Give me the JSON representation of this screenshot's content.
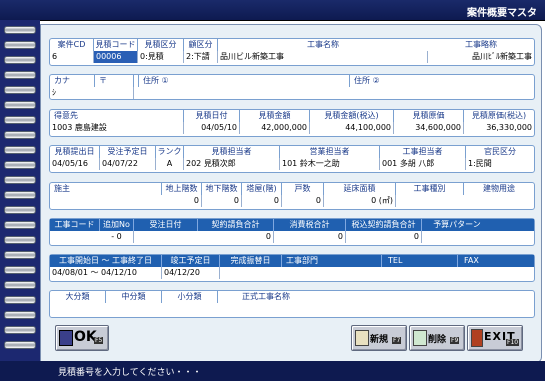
{
  "window": {
    "title": "案件概要マスタ"
  },
  "row1": {
    "headers": [
      "案件CD",
      "見積コード",
      "見積区分",
      "顧区分",
      "工事名称",
      "工事略称"
    ],
    "values": [
      "6",
      "00006",
      "0:見積",
      "2:下請",
      "品川ビル新築工事",
      "品川ﾋﾞﾙ新築工事"
    ]
  },
  "row2": {
    "headers": [
      "カナ",
      "〒",
      "住所 ①",
      "住所 ②"
    ],
    "values": [
      "ｼ",
      "",
      "",
      ""
    ]
  },
  "row3": {
    "headers": [
      "得意先",
      "見積日付",
      "見積金額",
      "見積金額(税込)",
      "見積原価",
      "見積原価(税込)"
    ],
    "values": [
      "1003 鹿島建設",
      "04/05/10",
      "42,000,000",
      "44,100,000",
      "34,600,000",
      "36,330,000"
    ]
  },
  "row4": {
    "headers": [
      "見積提出日",
      "受注予定日",
      "ランク",
      "見積担当者",
      "営業担当者",
      "工事担当者",
      "官民区分"
    ],
    "values": [
      "04/05/16",
      "04/07/22",
      "A",
      "202 見積次郎",
      "101 鈴木一之助",
      "001 多胡 八郎",
      "1:民間"
    ]
  },
  "row5": {
    "headers": [
      "施主",
      "地上階数",
      "地下階数",
      "塔屋(階)",
      "戸数",
      "延床面積",
      "工事種別",
      "建物用途"
    ],
    "values": [
      "",
      "0",
      "0",
      "0",
      "0",
      "0 (㎡)",
      "",
      ""
    ]
  },
  "row6": {
    "headers": [
      "工事コード",
      "追加No",
      "受注日付",
      "契約請負合計",
      "消費税合計",
      "税込契約請負合計",
      "予算パターン"
    ],
    "values": [
      "",
      "- 0",
      "",
      "0",
      "0",
      "0",
      ""
    ]
  },
  "row7": {
    "headers": [
      "工事開始日 ～ 工事終了日",
      "竣工予定日",
      "完成振替日",
      "工事部門",
      "TEL",
      "FAX"
    ],
    "values": [
      "04/08/01 ～ 04/12/10",
      "04/12/20",
      "",
      "",
      "",
      ""
    ]
  },
  "row8": {
    "headers": [
      "大分類",
      "中分類",
      "小分類",
      "正式工事名称"
    ],
    "values": [
      "",
      "",
      "",
      ""
    ]
  },
  "buttons": {
    "ok": {
      "label": "OK",
      "key": "F5"
    },
    "new": {
      "label": "新規",
      "key": "F7"
    },
    "delete": {
      "label": "削除",
      "key": "F9"
    },
    "exit": {
      "label": "EXIT",
      "key": "F10"
    }
  },
  "status": {
    "message": "見積番号を入力してください・・・"
  }
}
